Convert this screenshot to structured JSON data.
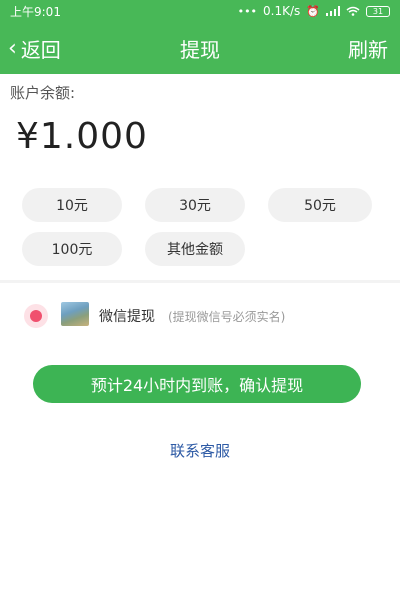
{
  "status_bar": {
    "time": "上午9:01",
    "dots": "•••",
    "speed": "0.1K/s",
    "battery": "31"
  },
  "nav": {
    "back_label": "返回",
    "title": "提现",
    "refresh_label": "刷新"
  },
  "balance": {
    "label": "账户余额:",
    "amount": "¥1.000"
  },
  "amount_options": [
    "10元",
    "30元",
    "50元",
    "100元",
    "其他金额"
  ],
  "payment": {
    "method_label": "微信提现",
    "hint": "(提现微信号必须实名)",
    "radio_color": "#f0506e"
  },
  "confirm_button": "预计24小时内到账，确认提现",
  "support_link": "联系客服",
  "colors": {
    "brand_green": "#48b857",
    "button_green": "#3db454",
    "link_blue": "#2d5aa5"
  }
}
